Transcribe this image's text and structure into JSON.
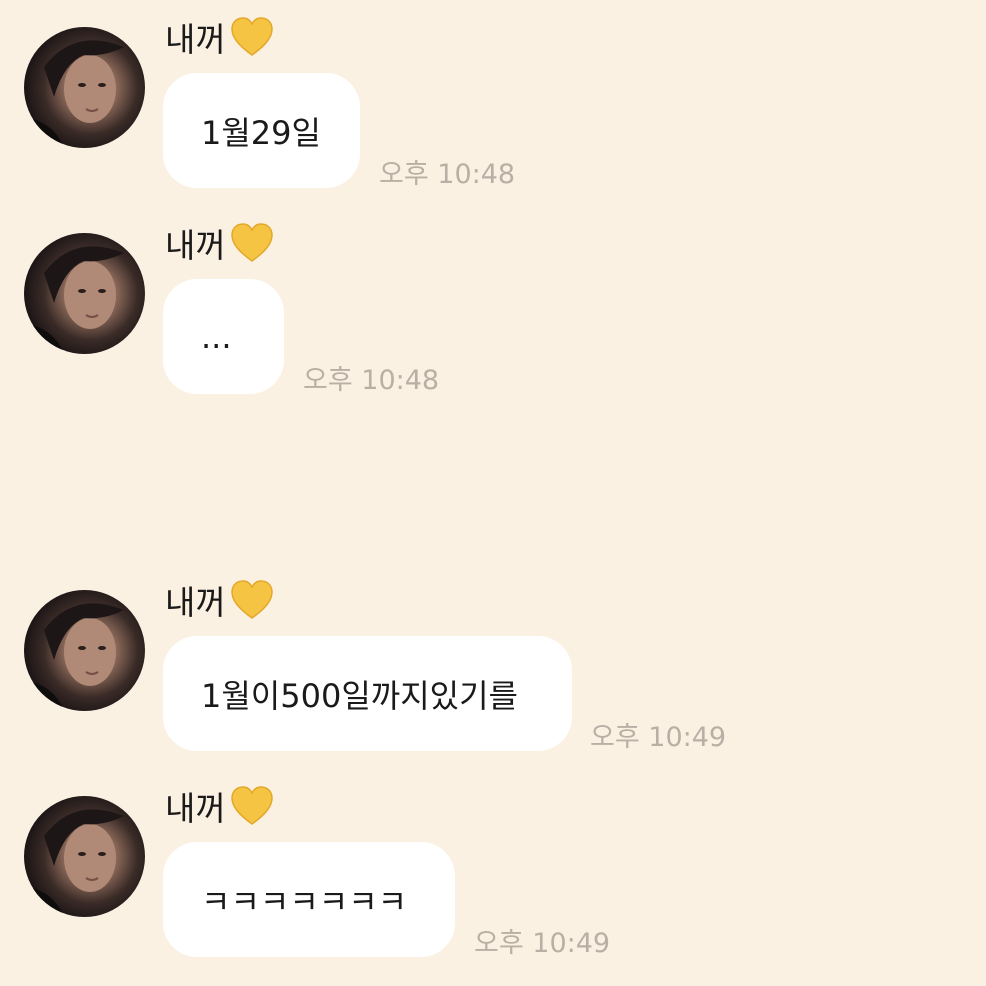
{
  "messages": [
    {
      "sender": "내꺼",
      "text": "1월29일",
      "time": "오후 10:48"
    },
    {
      "sender": "내꺼",
      "text": "...",
      "time": "오후 10:48"
    },
    {
      "sender": "내꺼",
      "text": "1월이500일까지있기를",
      "time": "오후 10:49"
    },
    {
      "sender": "내꺼",
      "text": "ㅋㅋㅋㅋㅋㅋㅋ",
      "time": "오후 10:49"
    }
  ],
  "colors": {
    "background": "#fbf1e3",
    "bubble": "#ffffff",
    "timestamp": "#b9afa5",
    "heart": "#f6c443"
  },
  "icons": {
    "sender_emoji": "yellow-heart-icon"
  }
}
